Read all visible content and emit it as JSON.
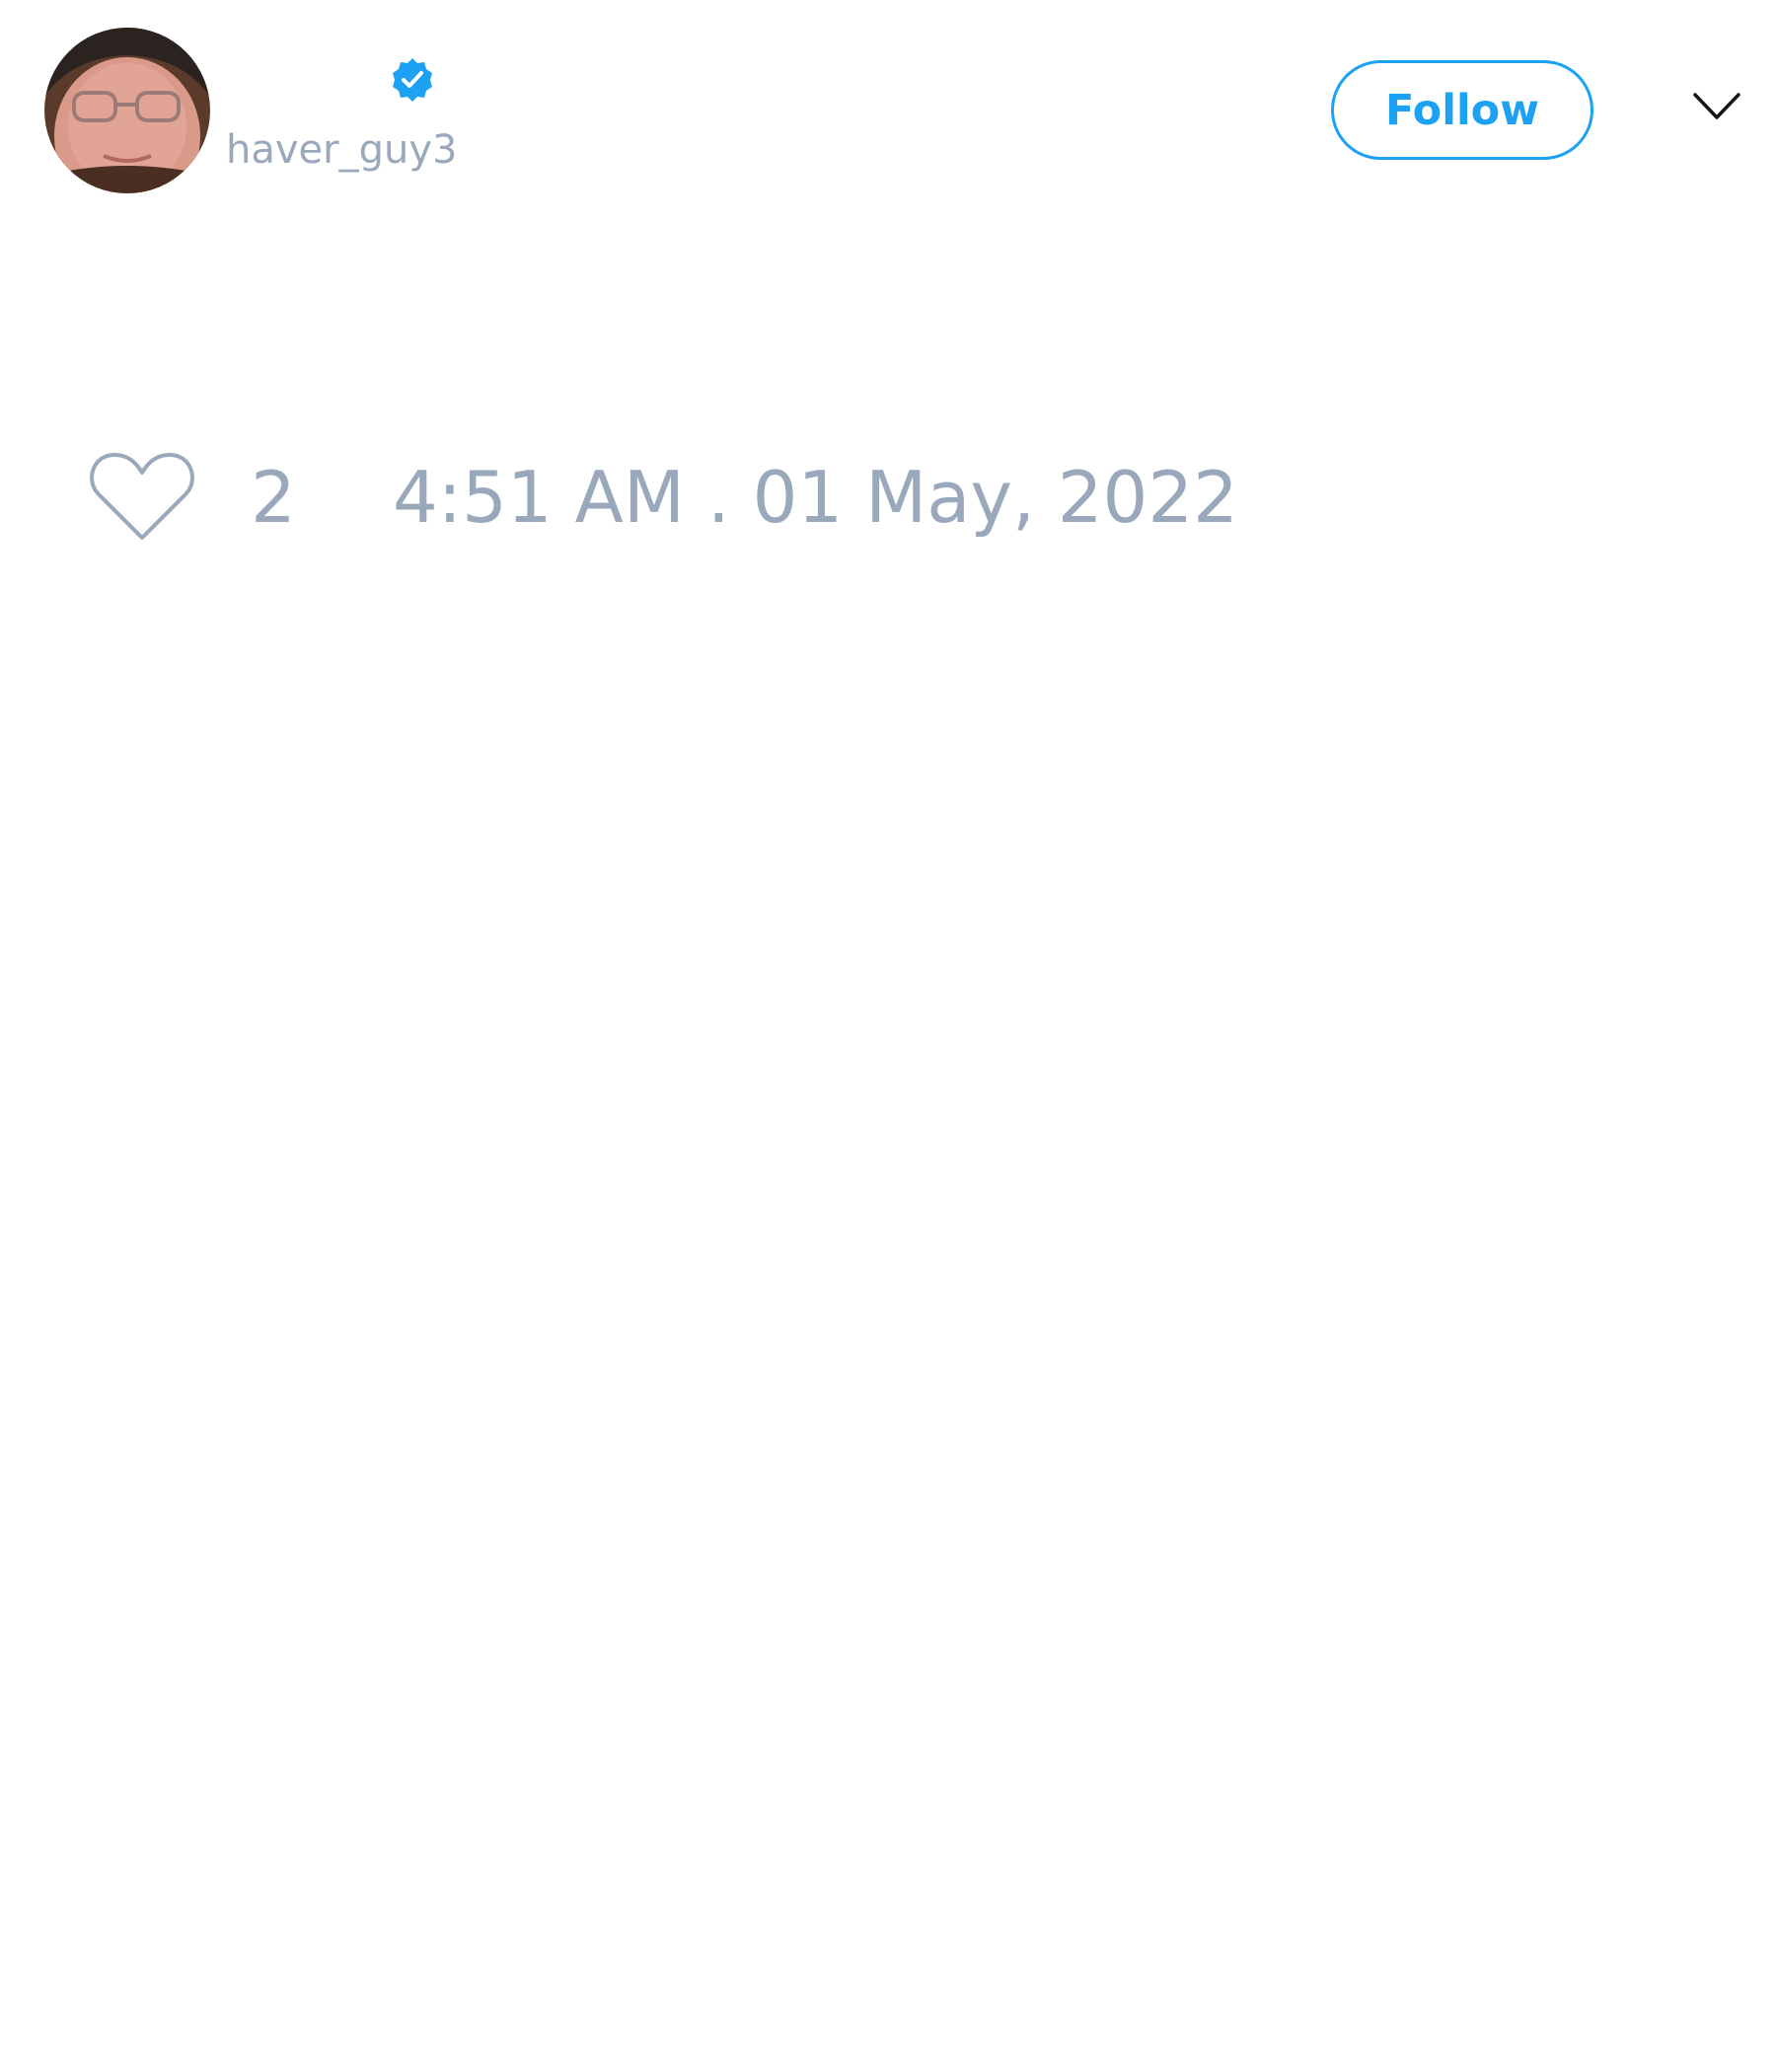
{
  "tweet": {
    "author": {
      "display_name": "",
      "handle": "haver_guy3",
      "verified": true,
      "avatar_icon": "profile-photo"
    },
    "follow_label": "Follow",
    "menu_icon": "chevron-down-icon",
    "likes": {
      "icon": "heart-icon",
      "count": "2"
    },
    "timestamp": "4:51 AM . 01 May, 2022"
  },
  "colors": {
    "accent": "#1da1f2",
    "muted_text": "#9aa8bb",
    "icon_gray": "#9aa8bb",
    "background": "#ffffff"
  }
}
